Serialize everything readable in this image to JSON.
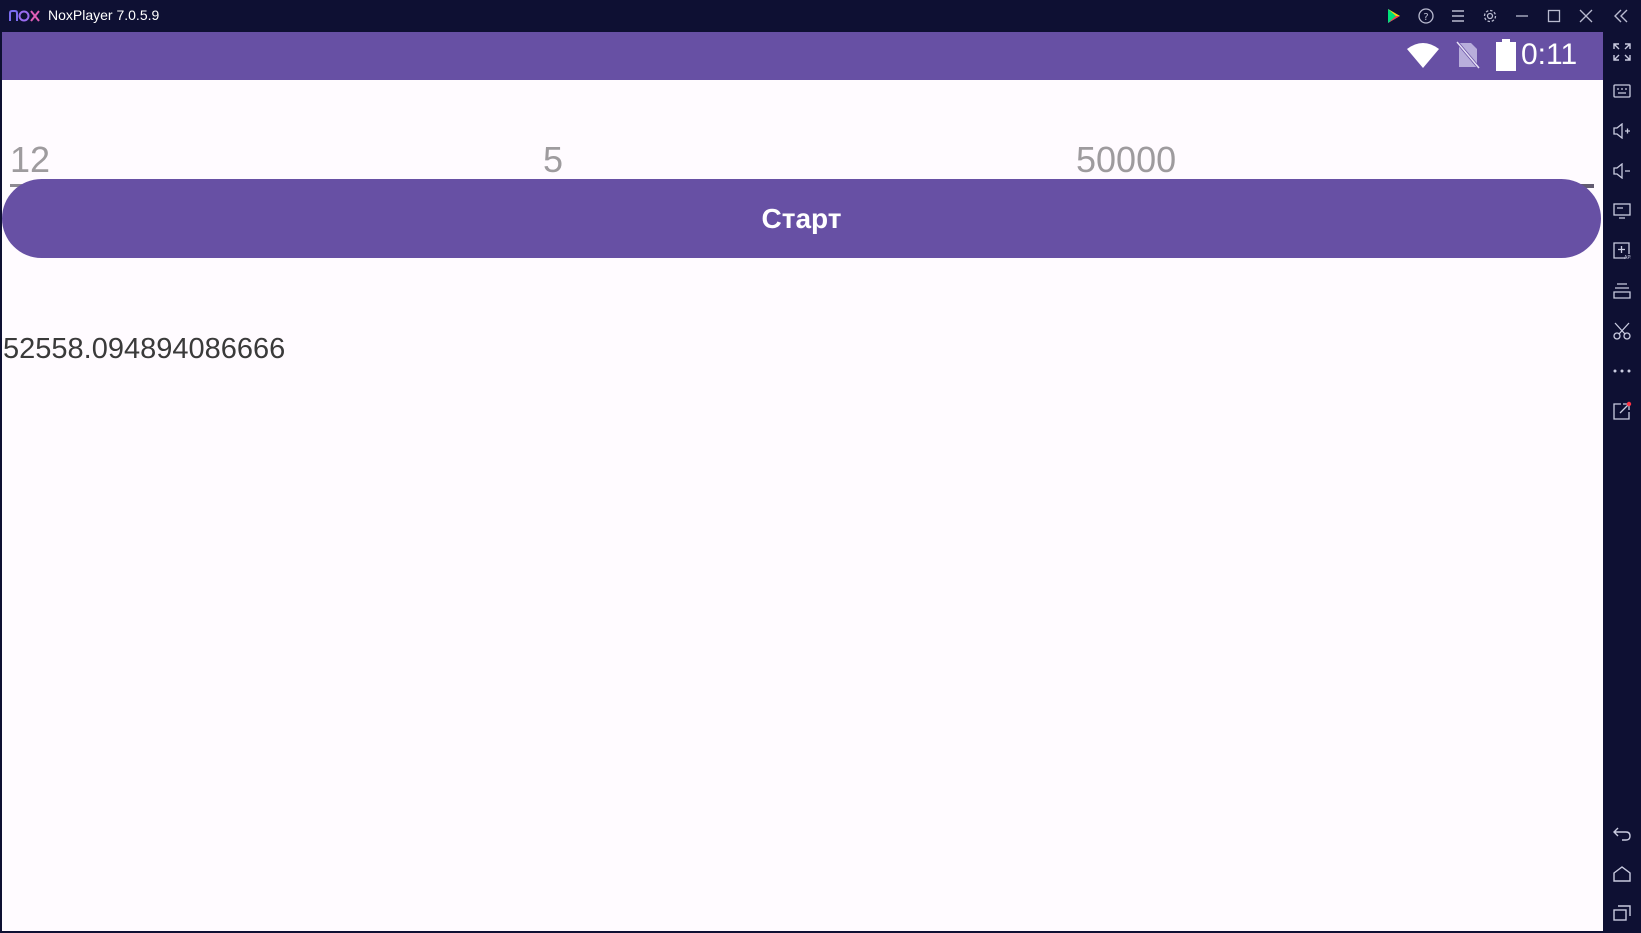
{
  "window": {
    "title": "NoxPlayer 7.0.5.9",
    "logo": "nox-logo",
    "controls": [
      "play-store-icon",
      "help-icon",
      "menu-icon",
      "settings-icon",
      "minimize-icon",
      "maximize-icon",
      "close-icon",
      "collapse-sidebar-icon"
    ]
  },
  "statusbar": {
    "time": "0:11",
    "icons": [
      "wifi-icon",
      "no-sim-icon",
      "battery-icon"
    ]
  },
  "inputs": [
    {
      "placeholder": "12",
      "value": ""
    },
    {
      "placeholder": "5",
      "value": ""
    },
    {
      "placeholder": "50000",
      "value": ""
    }
  ],
  "start_button": {
    "label": "Старт"
  },
  "result_text": "52558.094894086666",
  "sidebar": {
    "top_icons": [
      "fullscreen-icon",
      "keyboard-icon",
      "volume-up-icon",
      "volume-down-icon",
      "screen-icon",
      "add-apk-icon",
      "multi-instance-icon",
      "screenshot-cut-icon",
      "more-icon",
      "share-icon"
    ],
    "bottom_icons": [
      "back-icon",
      "home-icon",
      "recent-apps-icon"
    ]
  },
  "colors": {
    "primary": "#6750a4",
    "frame": "#0e1033",
    "background": "#fffbff"
  }
}
